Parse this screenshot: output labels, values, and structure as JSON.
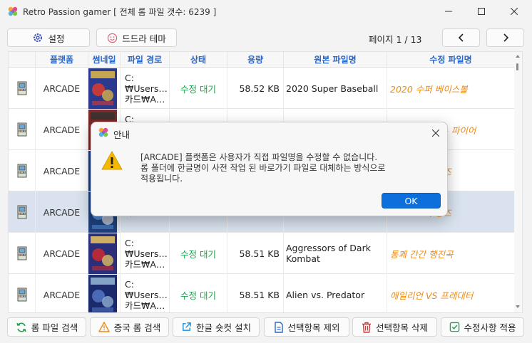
{
  "window": {
    "title": "Retro Passion gamer [ 전체 롬 파일 갯수: 6239 ]",
    "minimize_icon": "minimize-icon",
    "maximize_icon": "maximize-icon",
    "close_icon": "close-icon"
  },
  "toolbar": {
    "settings_label": "설정",
    "theme_label": "드드라 테마",
    "page_label": "페이지 1 / 13",
    "prev_icon": "chevron-left-icon",
    "next_icon": "chevron-right-icon"
  },
  "table": {
    "columns": [
      "",
      "플랫폼",
      "썸네일",
      "파일 경로",
      "상태",
      "용량",
      "원본 파일명",
      "수정 파일명"
    ],
    "rows": [
      {
        "platform": "ARCADE",
        "path1": "C:",
        "path2": "₩Users…",
        "path3": "카드₩A…",
        "status": "수정 대기",
        "size": "58.52 KB",
        "original": "2020 Super Baseball",
        "modified": "2020 수퍼 베이스볼",
        "selected": false
      },
      {
        "platform": "ARCADE",
        "path1": "C:",
        "path2": "₩Users…",
        "path3": "카드₩A…",
        "status": "",
        "size": "",
        "original": "",
        "modified": "3 카운트 바웃 - 파이어",
        "selected": false
      },
      {
        "platform": "ARCADE",
        "path1": "",
        "path2": "",
        "path3": "",
        "status": "",
        "size": "",
        "original": "",
        "modified": "즈 2 - 소닉 윙즈",
        "selected": false
      },
      {
        "platform": "ARCADE",
        "path1": "",
        "path2": "",
        "path3": "카드₩A…",
        "status": "",
        "size": "",
        "original": "",
        "modified": "즈 3 - 소닉 윙즈",
        "selected": true
      },
      {
        "platform": "ARCADE",
        "path1": "C:",
        "path2": "₩Users…",
        "path3": "카드₩A…",
        "status": "수정 대기",
        "size": "58.51 KB",
        "original": "Aggressors of Dark Kombat",
        "modified": "통쾌 간간 행진곡",
        "selected": false
      },
      {
        "platform": "ARCADE",
        "path1": "C:",
        "path2": "₩Users…",
        "path3": "카드₩A…",
        "status": "수정 대기",
        "size": "58.51 KB",
        "original": "Alien vs. Predator",
        "modified": "에일리언 VS 프레대터",
        "selected": false
      }
    ]
  },
  "dialog": {
    "title": "안내",
    "message_line1": "[ARCADE] 플랫폼은 사용자가 직접 파일명을 수정할 수 없습니다.",
    "message_line2": "롬 폴더에 한글명이 사전 작업 된 바로가기 파일로 대체하는 방식으로",
    "message_line3": "적용됩니다.",
    "ok_label": "OK",
    "warning_icon": "warning-icon"
  },
  "bottombar": {
    "rom_search": "롬 파일 검색",
    "china_rom_search": "중국 롬 검색",
    "shortcut_install": "한글 숏컷 설치",
    "exclude_selected": "선택항목 제외",
    "delete_selected": "선택항목 삭제",
    "apply_changes": "수정사항 적용"
  },
  "colors": {
    "accent": "#0d6fdc",
    "header_text": "#2a67c9",
    "status_green": "#1aa349",
    "modified_orange": "#f08a12",
    "selected_row": "#d9e2ee"
  }
}
